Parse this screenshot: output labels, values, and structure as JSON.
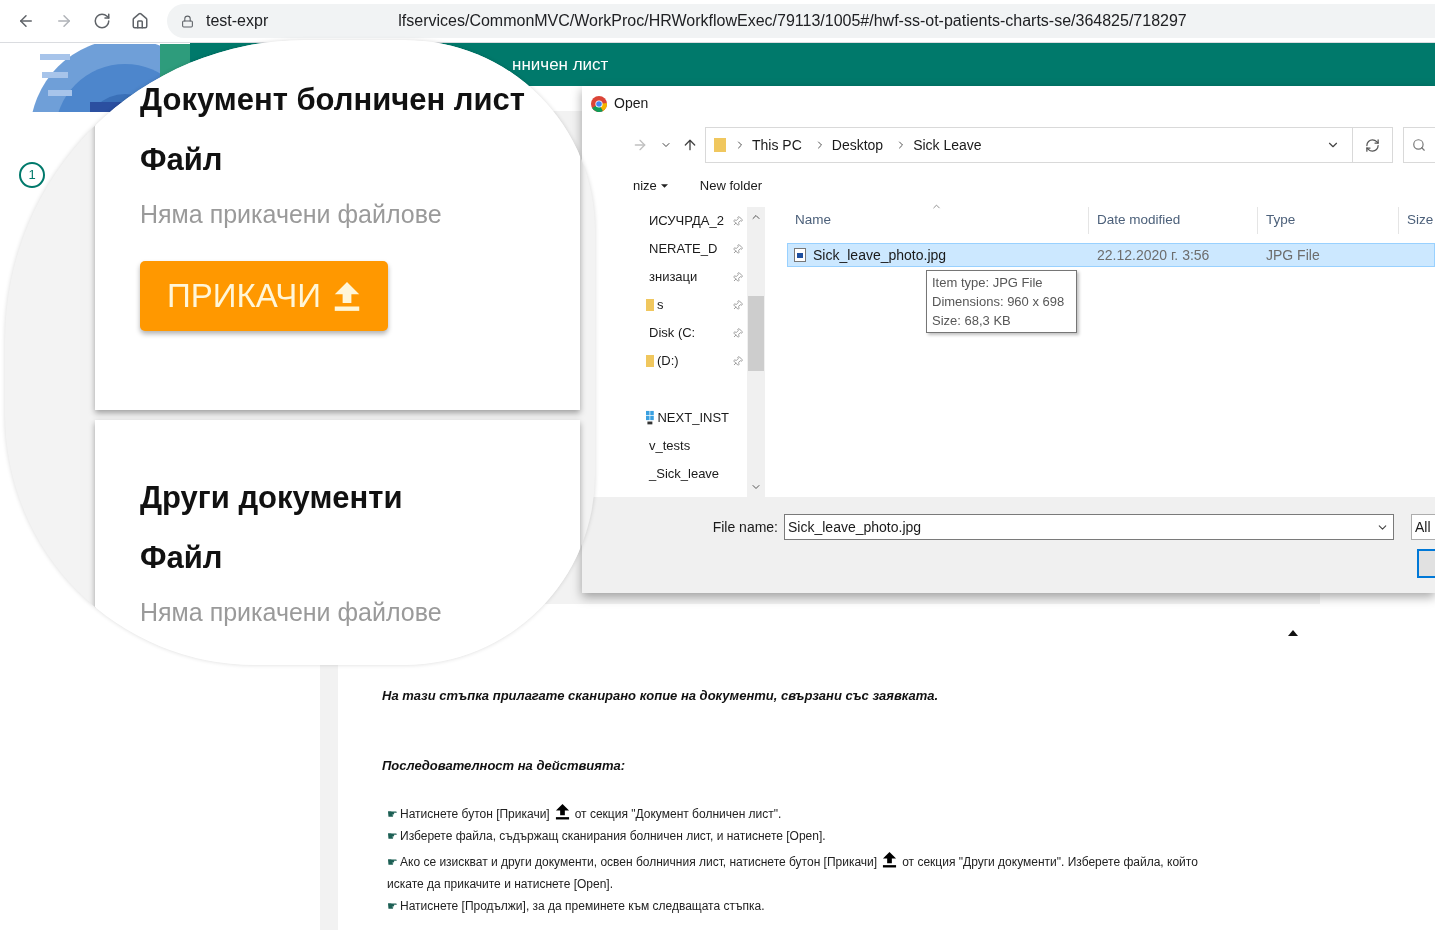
{
  "browser": {
    "url_start": "test-expr",
    "url_end": "lfservices/CommonMVC/WorkProc/HRWorkflowExec/79113/1005#/hwf-ss-ot-patients-charts-se/364825/718297",
    "forward_disabled": true
  },
  "header": {
    "title": "нничен лист"
  },
  "stepper": {
    "step": "1"
  },
  "magnifier": {
    "cards": [
      {
        "title": "Документ болничен лист",
        "field_label": "Файл",
        "empty_text": "Няма прикачени файлове",
        "button": "ПРИКАЧИ"
      },
      {
        "title": "Други документи",
        "field_label": "Файл",
        "empty_text": "Няма прикачени файлове"
      }
    ]
  },
  "dialog": {
    "title": "Open",
    "path": [
      "This PC",
      "Desktop",
      "Sick Leave"
    ],
    "toolbar": [
      {
        "label": "nize",
        "menu": true
      },
      {
        "label": "New folder",
        "menu": false
      }
    ],
    "nav_items": [
      {
        "label": "ИСУЧРДА_2",
        "pinned": true,
        "kind": "plain",
        "gap_before": false
      },
      {
        "label": "NERATE_D",
        "pinned": true,
        "kind": "plain",
        "gap_before": false
      },
      {
        "label": "знизаци",
        "pinned": true,
        "kind": "plain",
        "gap_before": false
      },
      {
        "label": "s",
        "pinned": true,
        "kind": "folder",
        "gap_before": false
      },
      {
        "label": "Disk (C:",
        "pinned": true,
        "kind": "plain",
        "gap_before": false
      },
      {
        "label": "(D:)",
        "pinned": true,
        "kind": "folder",
        "gap_before": false
      },
      {
        "label": "NEXT_INST",
        "pinned": false,
        "kind": "windows",
        "gap_before": true
      },
      {
        "label": "v_tests",
        "pinned": false,
        "kind": "plain",
        "gap_before": false
      },
      {
        "label": "_Sick_leave",
        "pinned": false,
        "kind": "plain",
        "gap_before": false
      }
    ],
    "columns": [
      "Name",
      "Date modified",
      "Type",
      "Size"
    ],
    "files": [
      {
        "name": "Sick_leave_photo.jpg",
        "date": "22.12.2020 г. 3:56",
        "type": "JPG File",
        "selected": true
      }
    ],
    "tooltip": [
      "Item type: JPG File",
      "Dimensions: 960 x 698",
      "Size: 68,3 KB"
    ],
    "file_name_label": "File name:",
    "file_name": "Sick_leave_photo.jpg",
    "filter": "All"
  },
  "help": {
    "intro": "На тази стъпка прилагате сканирано копие на документи, свързани със заявката.",
    "heading": "Последователност на действията:",
    "steps": [
      {
        "bullet": "☛",
        "text": "Натиснете бутон [Прикачи]",
        "icon": true,
        "after": "от секция \"Документ болничен лист\"."
      },
      {
        "bullet": "☛",
        "text": "Изберете файла, съдържащ сканирания болничен лист, и натиснете [Open].",
        "icon": false
      },
      {
        "bullet": "☛",
        "text": "Ако се изискват и други документи, освен болничния лист, натиснете бутон [Прикачи]",
        "icon": true,
        "after": "от секция \"Други документи\". Изберете файла, който",
        "more": "искате да прикачите и натиснете [Open]."
      },
      {
        "bullet": "☛",
        "text": "Натиснете [Продължи], за да преминете към следващата стъпка.",
        "icon": false
      }
    ]
  }
}
